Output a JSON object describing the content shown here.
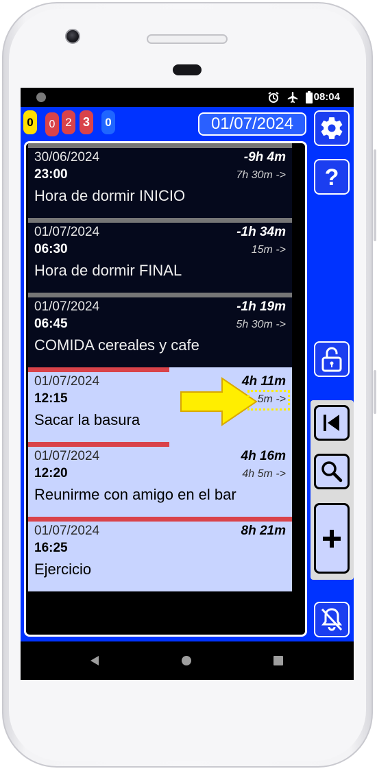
{
  "status_bar": {
    "time": "08:04",
    "icons": [
      "alarm-icon",
      "airplane-icon",
      "battery-icon"
    ]
  },
  "counters": [
    {
      "value": "0",
      "bg": "#ffe000",
      "fg": "#000000"
    },
    {
      "value": "0",
      "bg": "#d9434a",
      "fg": "#ffffff"
    },
    {
      "value": "2",
      "bg": "#d9434a",
      "fg": "#ffffff"
    },
    {
      "value": "3",
      "bg": "#d9434a",
      "fg": "#ffffff"
    },
    {
      "value": "0",
      "bg": "#1f66ff",
      "fg": "#ffffff"
    }
  ],
  "header": {
    "date": "01/07/2024"
  },
  "events": [
    {
      "date": "30/06/2024",
      "time": "23:00",
      "ago": "-9h 4m",
      "gap": "7h 30m ->",
      "title": "Hora de dormir INICIO",
      "style": "dark"
    },
    {
      "date": "01/07/2024",
      "time": "06:30",
      "ago": "-1h 34m",
      "gap": "15m ->",
      "title": "Hora de dormir FINAL",
      "style": "dark"
    },
    {
      "date": "01/07/2024",
      "time": "06:45",
      "ago": "-1h 19m",
      "gap": "5h 30m ->",
      "title": "COMIDA cereales y cafe",
      "style": "dark"
    },
    {
      "date": "01/07/2024",
      "time": "12:15",
      "ago": "4h 11m",
      "gap": "5m ->",
      "title": "Sacar la basura",
      "style": "light"
    },
    {
      "date": "01/07/2024",
      "time": "12:20",
      "ago": "4h 16m",
      "gap": "4h 5m ->",
      "title": "Reunirme con amigo en el bar",
      "style": "light"
    },
    {
      "date": "01/07/2024",
      "time": "16:25",
      "ago": "8h 21m",
      "gap": "",
      "title": "Ejercicio",
      "style": "light"
    }
  ],
  "side_buttons": [
    "gear-icon",
    "help-icon",
    "unlock-icon",
    "skip-to-start-icon",
    "search-icon",
    "plus-icon",
    "bell-off-icon"
  ],
  "colors": {
    "screen_bg": "#0033ff",
    "light_row": "#c8d4ff",
    "dark_row": "#05091c",
    "accent_red": "#d9434a",
    "highlight_yellow": "#ffee00"
  }
}
